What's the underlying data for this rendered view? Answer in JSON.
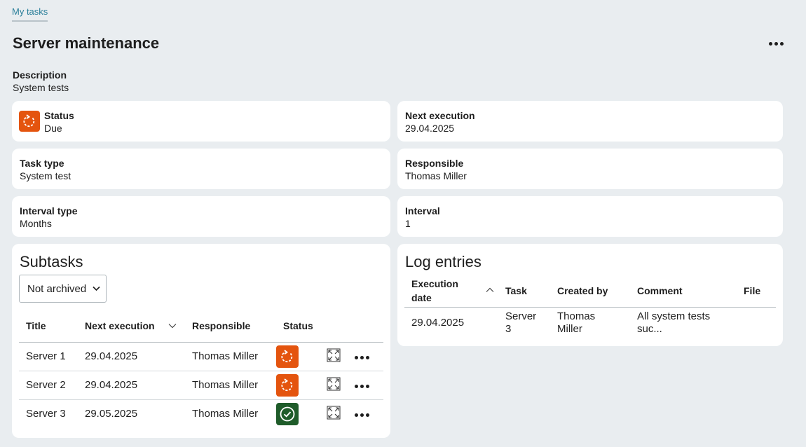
{
  "breadcrumb": {
    "tab_label": "My tasks"
  },
  "header": {
    "title": "Server maintenance"
  },
  "description": {
    "label": "Description",
    "value": "System tests"
  },
  "fields": {
    "status": {
      "label": "Status",
      "value": "Due",
      "icon": "refresh-icon",
      "color": "#e4540e"
    },
    "next_execution": {
      "label": "Next execution",
      "value": "29.04.2025"
    },
    "task_type": {
      "label": "Task type",
      "value": "System test"
    },
    "responsible": {
      "label": "Responsible",
      "value": "Thomas Miller"
    },
    "interval_type": {
      "label": "Interval type",
      "value": "Months"
    },
    "interval": {
      "label": "Interval",
      "value": "1"
    }
  },
  "subtasks": {
    "title": "Subtasks",
    "filter": {
      "selected": "Not archived"
    },
    "columns": [
      "Title",
      "Next execution",
      "Responsible",
      "Status"
    ],
    "rows": [
      {
        "title": "Server 1",
        "next_execution": "29.04.2025",
        "responsible": "Thomas Miller",
        "status": "due"
      },
      {
        "title": "Server 2",
        "next_execution": "29.04.2025",
        "responsible": "Thomas Miller",
        "status": "due"
      },
      {
        "title": "Server 3",
        "next_execution": "29.05.2025",
        "responsible": "Thomas Miller",
        "status": "done"
      }
    ]
  },
  "log": {
    "title": "Log entries",
    "columns": {
      "execution_date_1": "Execution",
      "execution_date_2": "date",
      "task": "Task",
      "created_by": "Created by",
      "comment": "Comment",
      "file": "File"
    },
    "rows": [
      {
        "execution_date": "29.04.2025",
        "task_1": "Server",
        "task_2": "3",
        "created_by_1": "Thomas",
        "created_by_2": "Miller",
        "comment_1": "All system tests",
        "comment_2": "suc..."
      }
    ]
  },
  "colors": {
    "status_due": "#e4540e",
    "status_done": "#1f5c2a",
    "accent": "#2a7f9a"
  }
}
